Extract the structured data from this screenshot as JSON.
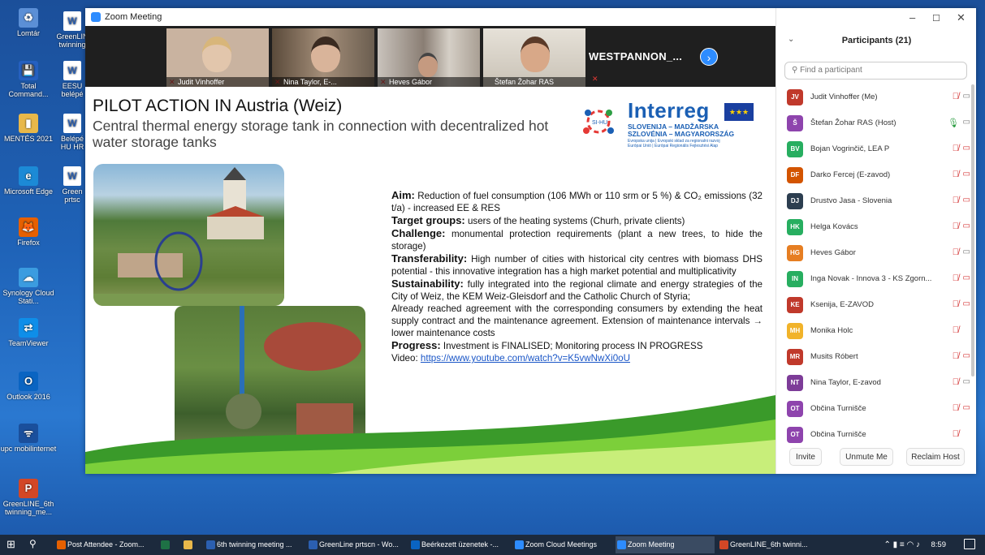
{
  "desktop": {
    "col1": [
      {
        "label": "Lomtár",
        "icon": "recycle-bin-icon",
        "color": "#5b8fd6",
        "glyph": "♻"
      },
      {
        "label": "Total Command...",
        "icon": "total-commander-icon",
        "color": "#2560c0",
        "glyph": "💾"
      },
      {
        "label": "MENTÉS 2021",
        "icon": "folder-icon",
        "color": "#e8b84a",
        "glyph": "▮"
      },
      {
        "label": "Microsoft Edge",
        "icon": "edge-icon",
        "color": "#1c8ad6",
        "glyph": "e"
      },
      {
        "label": "Firefox",
        "icon": "firefox-icon",
        "color": "#e66000",
        "glyph": "🦊"
      },
      {
        "label": "Synology Cloud Stati...",
        "icon": "synology-icon",
        "color": "#3b9ce0",
        "glyph": "☁"
      },
      {
        "label": "TeamViewer",
        "icon": "teamviewer-icon",
        "color": "#0e8ee9",
        "glyph": "⇄"
      },
      {
        "label": "Outlook 2016",
        "icon": "outlook-icon",
        "color": "#0a64c2",
        "glyph": "O"
      },
      {
        "label": "upc mobilinternet",
        "icon": "wifi-icon",
        "color": "#1a4f9c",
        "glyph": "ᯤ"
      },
      {
        "label": "GreenLINE_6th twinning_me...",
        "icon": "powerpoint-icon",
        "color": "#d24726",
        "glyph": "P"
      }
    ],
    "col2": [
      {
        "label": "GreenLIN twinning"
      },
      {
        "label": "EESU belépé"
      },
      {
        "label": "Belépé HU HR"
      },
      {
        "label": "Green prtsc"
      }
    ]
  },
  "zoom": {
    "title": "Zoom Meeting",
    "thumbs": [
      {
        "name": "Judit Vinhoffer"
      },
      {
        "name": "Nina Taylor, E-..."
      },
      {
        "name": "Heves Gábor"
      },
      {
        "name": "Štefan Žohar RAS"
      }
    ],
    "overflow_label": "WESTPANNON_...",
    "slide": {
      "heading": "PILOT ACTION IN Austria (Weiz)",
      "subheading": "Central thermal energy storage tank in connection with decentralized hot water storage tanks",
      "logo": {
        "name": "Interreg",
        "line1": "SLOVENIJA – MADŽARSKA",
        "line2": "SZLOVÉNIA – MAGYARORSZÁG",
        "line3": "Evropska unija | Evropski sklad za regionalni razvoj",
        "line4": "Európai Unió | Európai Regionális Fejlesztési Alap",
        "badge": "SI-HU"
      },
      "aim_label": "Aim:",
      "aim_text": " Reduction of fuel consumption (106 MWh or 110 srm or 5 %) & CO₂ emissions (32 t/a) - increased EE & RES",
      "target_label": "Target groups:",
      "target_text": " users of the heating systems (Churh, private clients)",
      "challenge_label": "Challenge:",
      "challenge_text": " monumental protection requirements (plant a new trees, to hide the storage)",
      "transfer_label": "Transferability:",
      "transfer_text": " High number of cities with historical city centres with biomass DHS potential - this innovative integration has a high market potential and multiplicativity",
      "sustain_label": "Sustainability:",
      "sustain_text": " fully integrated into the regional climate and energy strategies of the City of Weiz, the KEM Weiz-Gleisdorf and the Catholic Church of Styria;",
      "agreement_text": "Already reached agreement with the corresponding consumers by extending the heat supply contract and the maintenance agreement. Extension of maintenance intervals → lower maintenance costs",
      "progress_label": "Progress:",
      "progress_text": " Investment is FINALISED; Monitoring process IN PROGRESS",
      "video_label": "Video:",
      "video_link": "https://www.youtube.com/watch?v=K5vwNwXi0oU"
    }
  },
  "participants": {
    "title": "Participants (21)",
    "search_placeholder": "Find a participant",
    "list": [
      {
        "initials": "JV",
        "name": "Judit Vinhoffer (Me)",
        "color": "#c0392b",
        "video": "on"
      },
      {
        "initials": "Š",
        "name": "Štefan Žohar RAS (Host)",
        "color": "#8e44ad",
        "video": "on",
        "mic": "active"
      },
      {
        "initials": "BV",
        "name": "Bojan Vogrinčič, LEA P",
        "color": "#27ae60",
        "video": "off"
      },
      {
        "initials": "DF",
        "name": "Darko Fercej (E-zavod)",
        "color": "#d35400",
        "video": "off"
      },
      {
        "initials": "DJ",
        "name": "Drustvo Jasa - Slovenia",
        "color": "#2c3e50",
        "video": "off"
      },
      {
        "initials": "HK",
        "name": "Helga Kovács",
        "color": "#27ae60",
        "video": "off"
      },
      {
        "initials": "HG",
        "name": "Heves Gábor",
        "color": "#e67e22",
        "video": "on"
      },
      {
        "initials": "IN",
        "name": "Inga Novak - Innova 3 - KS Zgorn...",
        "color": "#27ae60",
        "video": "off"
      },
      {
        "initials": "KE",
        "name": "Ksenija, E-ZAVOD",
        "color": "#c0392b",
        "video": "off"
      },
      {
        "initials": "MH",
        "name": "Monika Holc",
        "color": "#f1b32a",
        "video": "none"
      },
      {
        "initials": "MR",
        "name": "Musits Róbert",
        "color": "#c0392b",
        "video": "off"
      },
      {
        "initials": "NT",
        "name": "Nina Taylor, E-zavod",
        "color": "#7d3c98",
        "video": "on"
      },
      {
        "initials": "OT",
        "name": "Občina Turnišče",
        "color": "#8e44ad",
        "video": "off"
      },
      {
        "initials": "OT",
        "name": "Občina Turnišče",
        "color": "#8e44ad",
        "video": "none"
      }
    ],
    "buttons": {
      "invite": "Invite",
      "unmute": "Unmute Me",
      "reclaim": "Reclaim Host"
    }
  },
  "taskbar": {
    "items": [
      {
        "label": "Post Attendee - Zoom...",
        "color": "#e66000"
      },
      {
        "label": "",
        "color": "#1e7145",
        "short": "X"
      },
      {
        "label": "",
        "color": "#e8b84a",
        "short": "F"
      },
      {
        "label": "6th twinning meeting ...",
        "color": "#2b5fb0"
      },
      {
        "label": "GreenLine prtscn - Wo...",
        "color": "#2b5fb0"
      },
      {
        "label": "Beérkezett üzenetek -...",
        "color": "#0a64c2"
      },
      {
        "label": "Zoom Cloud Meetings",
        "color": "#2d8cff"
      },
      {
        "label": "Zoom Meeting",
        "color": "#2d8cff",
        "active": true
      },
      {
        "label": "GreenLINE_6th twinni...",
        "color": "#d24726"
      }
    ],
    "time": "8:59"
  }
}
